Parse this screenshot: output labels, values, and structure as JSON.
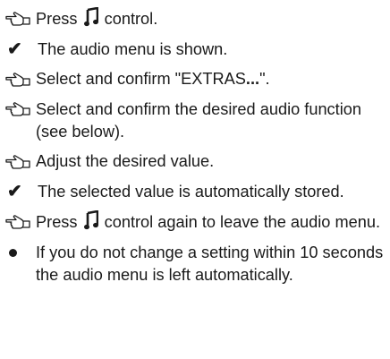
{
  "steps": [
    {
      "type": "action",
      "before": "Press",
      "icon": "music-note-icon",
      "after": "control."
    },
    {
      "type": "result",
      "text": "The audio menu is shown."
    },
    {
      "type": "action",
      "before": "Select and confirm \"EXTRAS",
      "bold": "...",
      "after": "\"."
    },
    {
      "type": "action",
      "text": "Select and confirm the desired audio function (see below)."
    },
    {
      "type": "action",
      "text": "Adjust the desired value."
    },
    {
      "type": "result",
      "text": "The selected value is automatically stored."
    },
    {
      "type": "action",
      "before": "Press",
      "icon": "music-note-icon",
      "after": "control again to leave the audio menu."
    },
    {
      "type": "note",
      "text": "If you do not change a setting within 10 seconds the audio menu is left automatically."
    }
  ],
  "icons": {
    "action": "pointing-hand-icon",
    "result": "checkmark-icon",
    "note": "bullet-icon",
    "control": "music-note-icon"
  },
  "colors": {
    "text": "#1a1a1a"
  }
}
